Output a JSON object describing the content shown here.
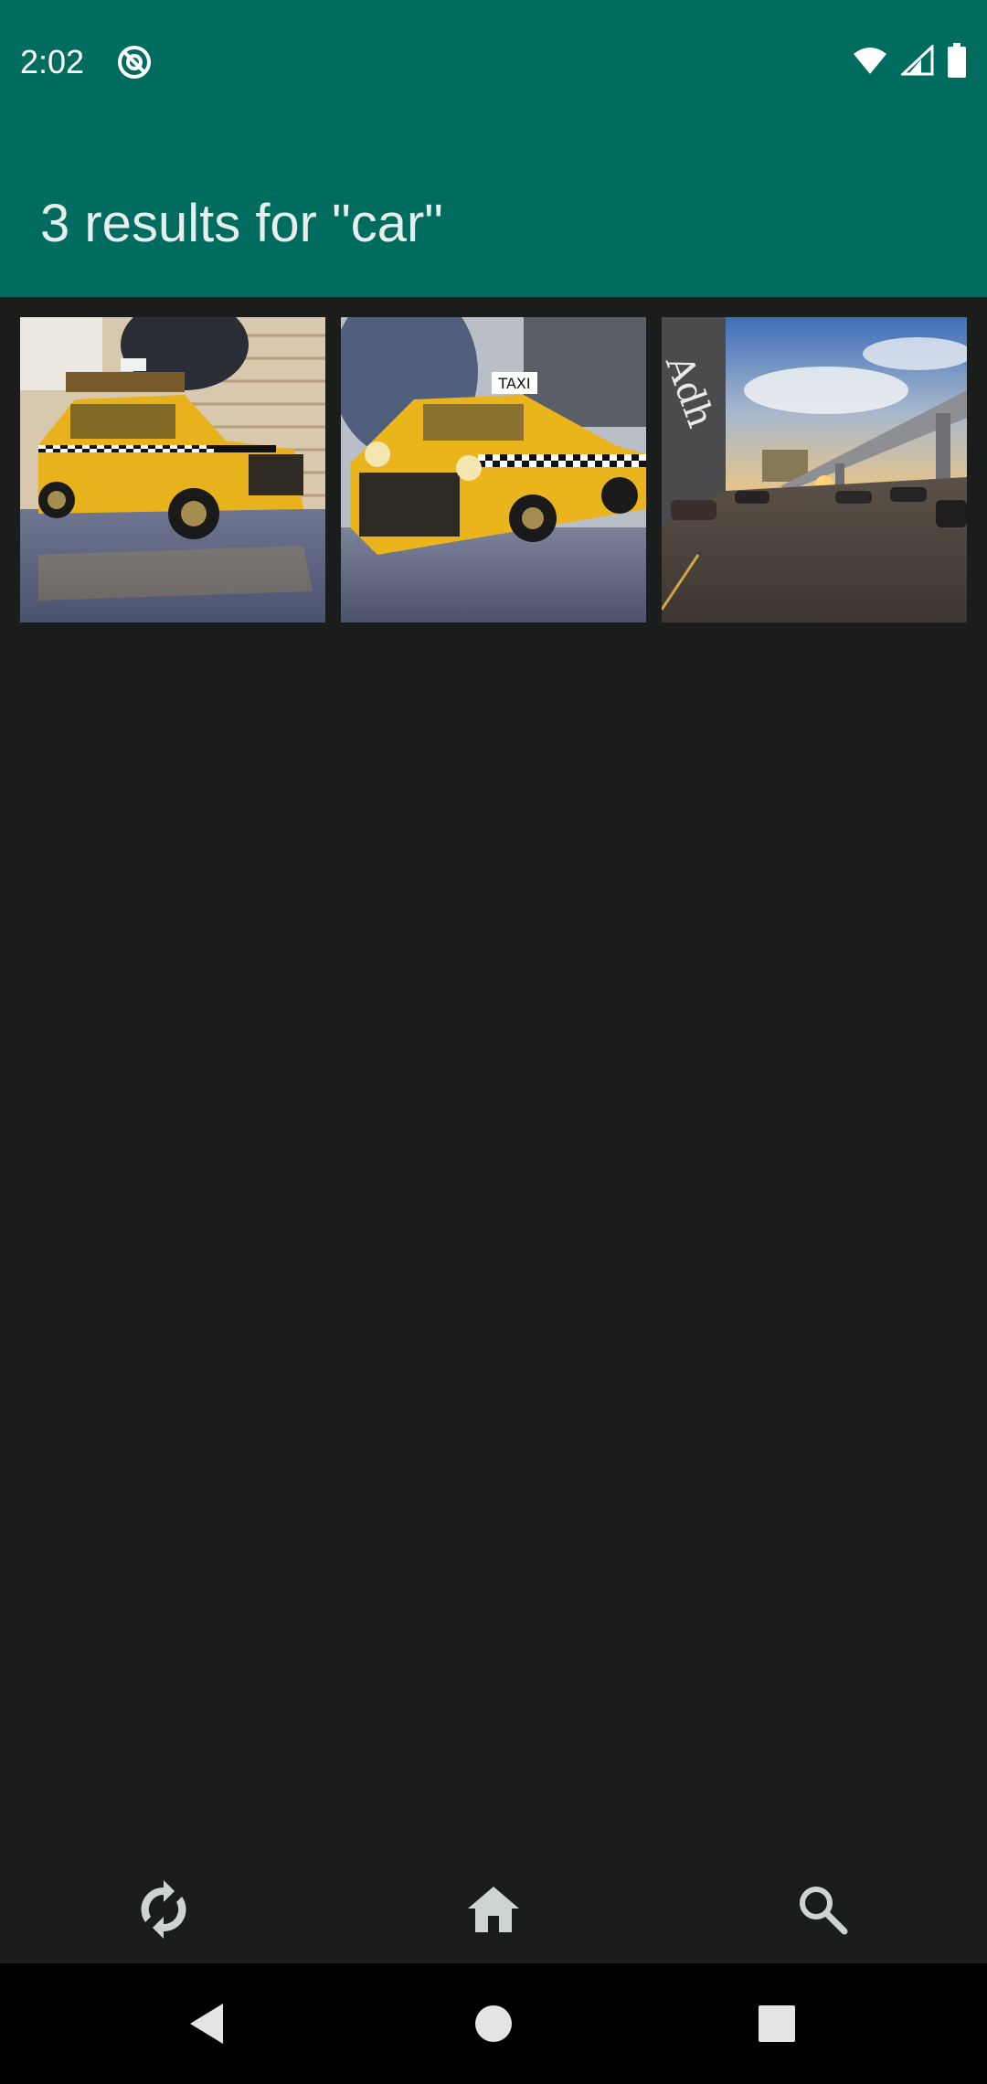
{
  "status_bar": {
    "time": "2:02",
    "icons": [
      "app-notification-icon",
      "wifi-icon",
      "signal-icon",
      "battery-icon"
    ]
  },
  "app_bar": {
    "title": "3 results for \"car\""
  },
  "results": [
    {
      "name": "toy-yellow-taxi-side-view",
      "description_icon": "image-thumbnail"
    },
    {
      "name": "toy-yellow-taxi-front-view",
      "description_icon": "image-thumbnail"
    },
    {
      "name": "parking-street-sunset",
      "description_icon": "image-thumbnail"
    }
  ],
  "bottom_nav": {
    "items": [
      "sync-icon",
      "home-icon",
      "search-icon"
    ]
  },
  "system_nav": {
    "items": [
      "back-icon",
      "home-circle-icon",
      "recents-icon"
    ]
  },
  "colors": {
    "app_bar": "#006b5f",
    "background": "#1b1c1c",
    "nav_icon": "#cdd5d2",
    "system_nav_bg": "#000000",
    "system_nav_icon": "#e4e4e4"
  }
}
